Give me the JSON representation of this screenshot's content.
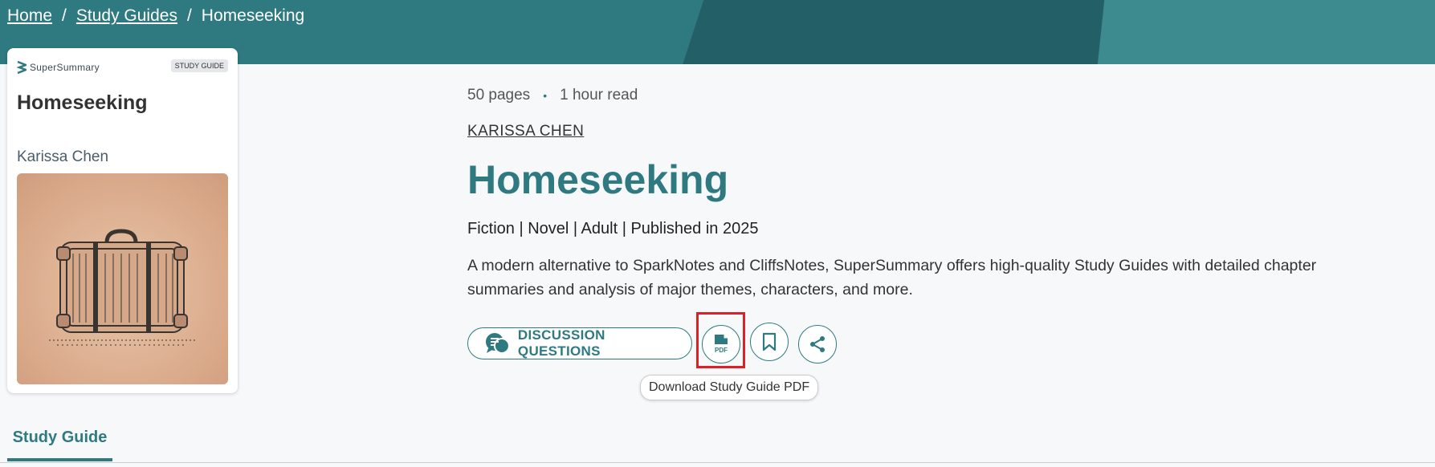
{
  "breadcrumb": {
    "home": "Home",
    "study_guides": "Study Guides",
    "current": "Homeseeking",
    "separator": "/"
  },
  "card": {
    "brand": "SuperSummary",
    "badge": "STUDY GUIDE",
    "title": "Homeseeking",
    "author": "Karissa Chen",
    "cover_icon": "suitcase-illustration"
  },
  "main": {
    "pages": "50 pages",
    "read_time": "1 hour read",
    "dot": "•",
    "author_link": "KARISSA CHEN",
    "title": "Homeseeking",
    "genre": "Fiction | Novel | Adult | Published in 2025",
    "description": "A modern alternative to SparkNotes and CliffsNotes, SuperSummary offers high-quality Study Guides with detailed chapter summaries and analysis of major themes, characters, and more."
  },
  "actions": {
    "discussion_label": "DISCUSSION QUESTIONS",
    "pdf_icon_text": "PDF",
    "tooltip": "Download Study Guide PDF"
  },
  "tabs": {
    "study_guide": "Study Guide"
  },
  "colors": {
    "accent": "#2e7a80",
    "highlight": "#e01e26"
  }
}
